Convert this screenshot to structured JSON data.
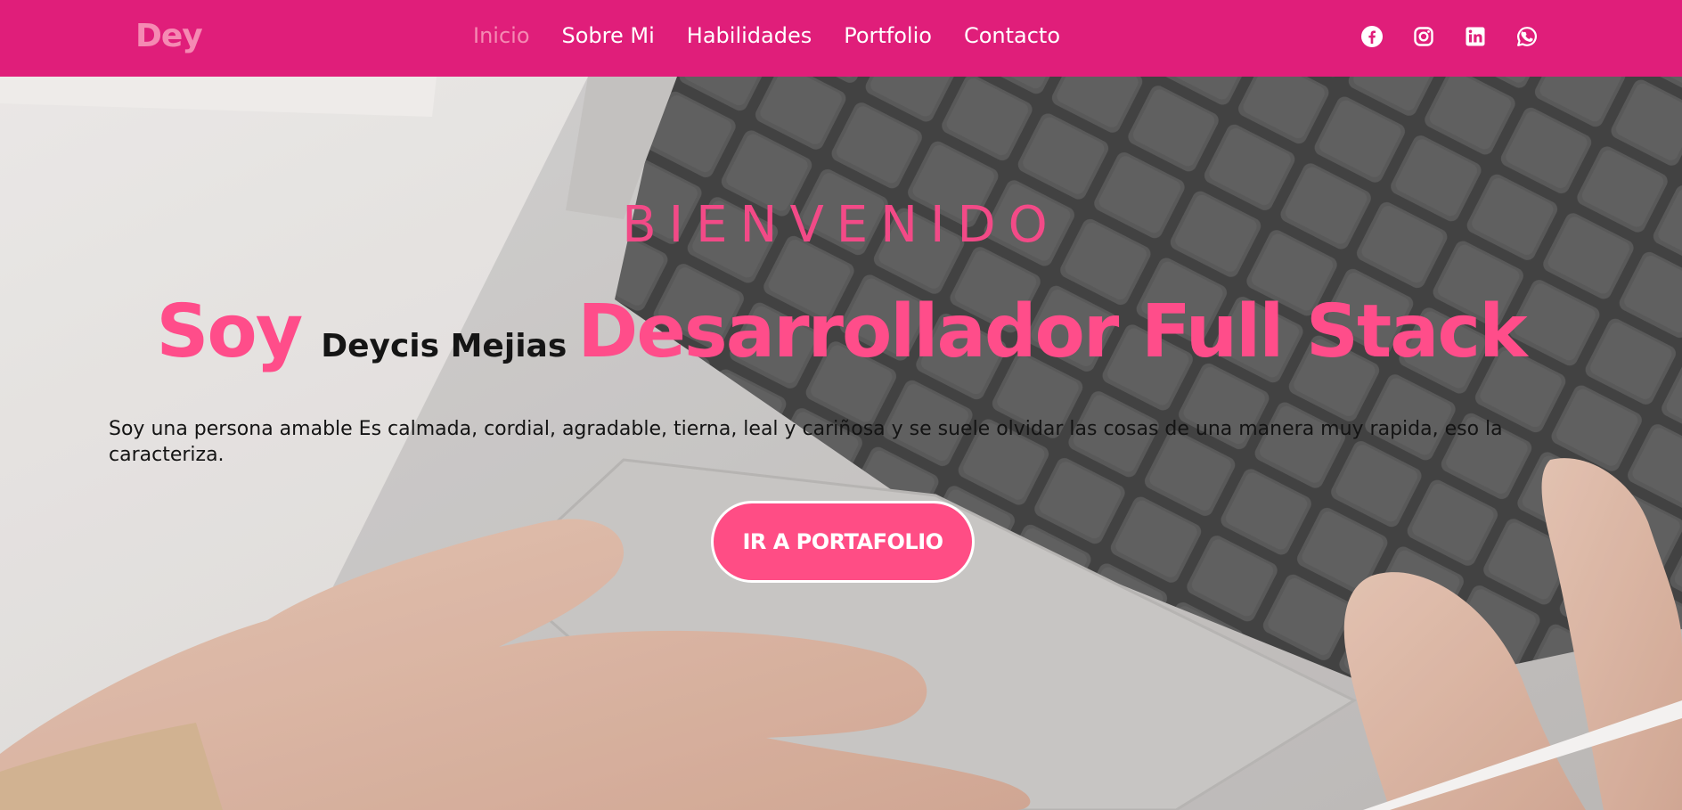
{
  "nav": {
    "logo": "Dey",
    "items": [
      {
        "label": "Inicio",
        "active": true
      },
      {
        "label": "Sobre Mi",
        "active": false
      },
      {
        "label": "Habilidades",
        "active": false
      },
      {
        "label": "Portfolio",
        "active": false
      },
      {
        "label": "Contacto",
        "active": false
      }
    ],
    "socials": [
      "facebook-icon",
      "instagram-icon",
      "linkedin-icon",
      "whatsapp-icon"
    ]
  },
  "hero": {
    "welcome": "BIENVENIDO",
    "soy": "Soy",
    "name": "Deycis Mejias",
    "role": "Desarrollador Full Stack",
    "description": "Soy una persona amable Es calmada, cordial, agradable, tierna, leal y cariñosa y se suele olvidar las cosas de una manera muy rapida, eso la caracteriza.",
    "cta": "IR A PORTAFOLIO"
  },
  "colors": {
    "nav_bg": "#e01e7a",
    "active_link": "#f58ab3",
    "accent_pink": "#ff4d8a",
    "cta_bg": "#ff4d85"
  }
}
